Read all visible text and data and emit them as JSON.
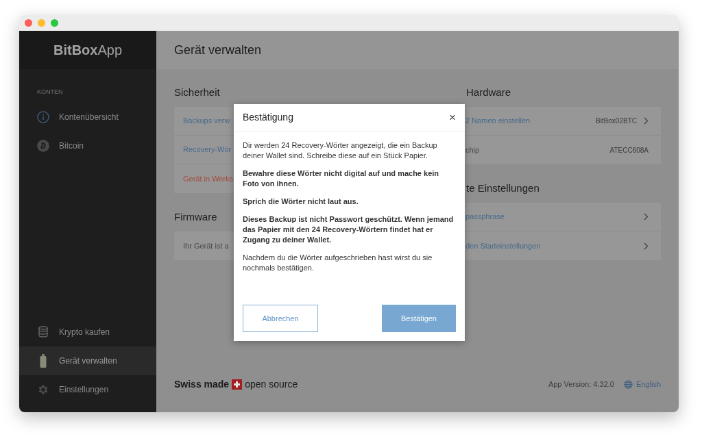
{
  "sidebar": {
    "logo": {
      "bold": "BitBox",
      "light": "App"
    },
    "section_label": "KONTEN",
    "items": [
      {
        "label": "Kontenübersicht",
        "kind": "info",
        "selected": false
      },
      {
        "label": "Bitcoin",
        "kind": "bitcoin",
        "selected": false
      }
    ],
    "bottom_items": [
      {
        "label": "Krypto kaufen",
        "kind": "coins",
        "selected": false
      },
      {
        "label": "Gerät verwalten",
        "kind": "device",
        "selected": true
      },
      {
        "label": "Einstellungen",
        "kind": "gear",
        "selected": false
      }
    ]
  },
  "main": {
    "title": "Gerät verwalten",
    "left_sections": [
      {
        "title": "Sicherheit",
        "rows": [
          {
            "label": "Backups verw",
            "kind": "link"
          },
          {
            "label": "Recovery-Wör",
            "kind": "link"
          },
          {
            "label": "Gerät in Werks",
            "kind": "danger"
          }
        ]
      },
      {
        "title": "Firmware",
        "rows": [
          {
            "label": "Ihr Gerät ist a",
            "kind": "text"
          }
        ]
      }
    ],
    "right_sections": [
      {
        "title": "Hardware",
        "rows": [
          {
            "label": "2 Namen einstellen",
            "kind": "link",
            "value": "BitBox02BTC",
            "chevron": true
          },
          {
            "label": "chip",
            "kind": "text",
            "value": "ATECC608A",
            "chevron": false
          }
        ]
      },
      {
        "title": "te Einstellungen",
        "rows": [
          {
            "label": "passphrase",
            "kind": "link",
            "chevron": true
          },
          {
            "label": "den Starteinstellungen",
            "kind": "link",
            "chevron": true
          }
        ]
      }
    ]
  },
  "footer": {
    "made": "Swiss made",
    "open": "open source",
    "version": "App Version: 4.32.0",
    "language": "English"
  },
  "dialog": {
    "title": "Bestätigung",
    "close": "×",
    "paragraphs": [
      {
        "text": "Dir werden 24 Recovery-Wörter angezeigt, die ein Backup deiner Wallet sind. Schreibe diese auf ein Stück Papier.",
        "bold": false
      },
      {
        "text": "Bewahre diese Wörter nicht digital auf und mache kein Foto von ihnen.",
        "bold": true
      },
      {
        "text": "Sprich die Wörter nicht laut aus.",
        "bold": true
      },
      {
        "text": "Dieses Backup ist nicht Passwort geschützt. Wenn jemand das Papier mit den 24 Recovery-Wörtern findet hat er Zugang zu deiner Wallet.",
        "bold": true
      },
      {
        "text": "Nachdem du die Wörter aufgeschrieben hast wirst du sie nochmals bestätigen.",
        "bold": false
      }
    ],
    "buttons": [
      {
        "label": "Abbrechen",
        "kind": "secondary"
      },
      {
        "label": "Bestätigen",
        "kind": "primary"
      }
    ]
  }
}
